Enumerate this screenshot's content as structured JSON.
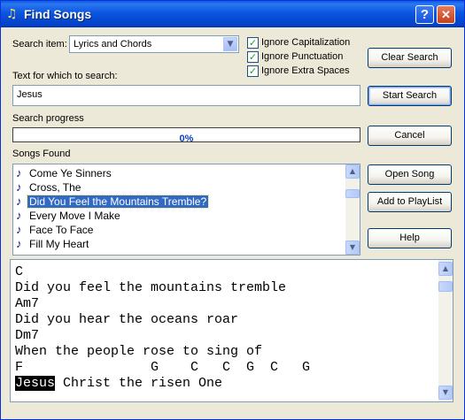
{
  "window": {
    "title": "Find Songs",
    "help_glyph": "?",
    "close_glyph": "✕"
  },
  "search_item": {
    "label": "Search item:",
    "value": "Lyrics and Chords"
  },
  "options": {
    "ignore_capitalization": {
      "label": "Ignore Capitalization",
      "checked": true
    },
    "ignore_punctuation": {
      "label": "Ignore Punctuation",
      "checked": true
    },
    "ignore_extra_spaces": {
      "label": "Ignore Extra Spaces",
      "checked": true
    }
  },
  "search_text": {
    "label": "Text for which to search:",
    "value": "Jesus"
  },
  "progress": {
    "label": "Search progress",
    "text": "0%",
    "value": 0
  },
  "songs_found": {
    "label": "Songs Found",
    "items": [
      "Come Ye Sinners",
      "Cross, The",
      "Did You Feel the Mountains Tremble?",
      "Every Move I Make",
      "Face To Face",
      "Fill My Heart"
    ],
    "selected_index": 2
  },
  "buttons": {
    "clear_search": "Clear Search",
    "start_search": "Start Search",
    "cancel": "Cancel",
    "open_song": "Open Song",
    "add_to_playlist": "Add to PlayList",
    "help": "Help"
  },
  "lyrics": {
    "lines": [
      "C",
      "Did you feel the mountains tremble",
      "Am7",
      "Did you hear the oceans roar",
      "Dm7",
      "When the people rose to sing of",
      "F                G    C   C  G  C   G"
    ],
    "match_word": "Jesus",
    "match_rest": " Christ the risen One"
  }
}
